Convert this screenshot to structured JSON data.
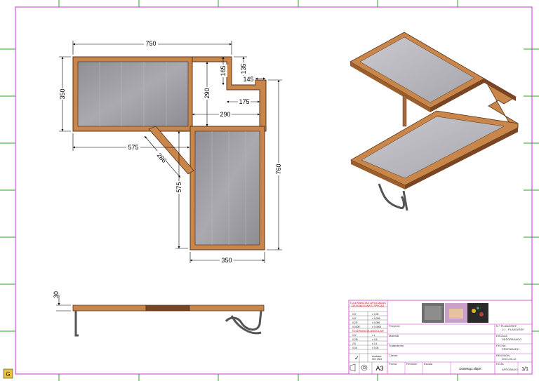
{
  "drawing": {
    "dimensions": {
      "top_width": "750",
      "left_height": "350",
      "notch_top": "165",
      "notch_right": "135",
      "notch_width": "145",
      "inner_width": "175",
      "inner_height": "290",
      "mid_width": "290",
      "bracket_offset": "575",
      "bracket_length": "286",
      "bracket_vertical": "575",
      "right_height": "760",
      "bottom_width": "350",
      "side_thickness": "30"
    },
    "colors": {
      "wood": "#c8864a",
      "wood_dark": "#5a3219",
      "glass": "#9a9aa0",
      "border": "#cc33cc",
      "grid": "#22aa22",
      "title_red": "#c00000"
    },
    "title_block": {
      "tolerances_header": "TOLERANCIAS APLICADAS",
      "tolerances_sub": "DESVIACIONES TÍPICAS",
      "tolerance_rows": [
        [
          "0,5\"",
          "± 0,05"
        ],
        [
          "0,5\"",
          "± 0,005"
        ],
        [
          "0,25\"",
          "± 0,005"
        ],
        [
          "0,0005\"",
          "± 0,0005"
        ]
      ],
      "angular_header": "TOLERANCIA ANGULAR",
      "angular_rows": [
        [
          "0,5º",
          "± 1"
        ],
        [
          "0,25º",
          "± 0,5"
        ],
        [
          "2,5",
          "± 0,1"
        ],
        [
          "0,05",
          "± 0,05"
        ]
      ],
      "check_symbol": "✓",
      "finish_label": "Acabado",
      "finish_value": "ISO 1302",
      "paper_size": "A3",
      "drawing_name": "Drawing1.sldprt",
      "sheet_number": "1/1",
      "field_labels": [
        "Proyecto",
        "Material",
        "Tratamiento",
        "Cliente",
        "Fecha",
        "Revisión",
        "Escala"
      ],
      "right_fields": [
        "N.º PLANO/REF.",
        "ESCALA",
        "FECHA",
        "REVISIÓN",
        "HOJA"
      ],
      "right_values": [
        "1:1 · PLANO/REF.",
        "DESGRASADO",
        "PREPARADO",
        "2021-05-12",
        "APROBADO"
      ]
    }
  }
}
